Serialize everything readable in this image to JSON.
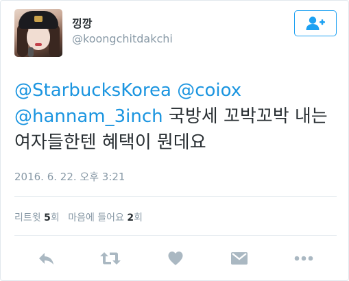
{
  "user": {
    "display_name": "낑깡",
    "username": "@koongchitdakchi"
  },
  "follow_button": {
    "icon": "follow-user-plus-icon"
  },
  "tweet": {
    "mention_1": "@StarbucksKorea",
    "mention_2": "@coiox",
    "mention_3": "@hannam_3inch",
    "text_line_1": "국방세 꼬박꼬박 내는",
    "text_line_2": "여자들한텐 혜택이 뭔데요"
  },
  "timestamp": "2016. 6. 22. 오후 3:21",
  "stats": {
    "retweets_label": "리트윗",
    "retweets_count": "5",
    "retweets_suffix": "회",
    "likes_label": "마음에 들어요",
    "likes_count": "2",
    "likes_suffix": "회"
  },
  "actions": {
    "reply": "reply-icon",
    "retweet": "retweet-icon",
    "like": "heart-icon",
    "message": "direct-message-icon",
    "more": "more-icon"
  },
  "colors": {
    "link": "#1b95e0",
    "brand": "#1da1f2",
    "muted": "#8899a6",
    "icon": "#aab8c2"
  }
}
